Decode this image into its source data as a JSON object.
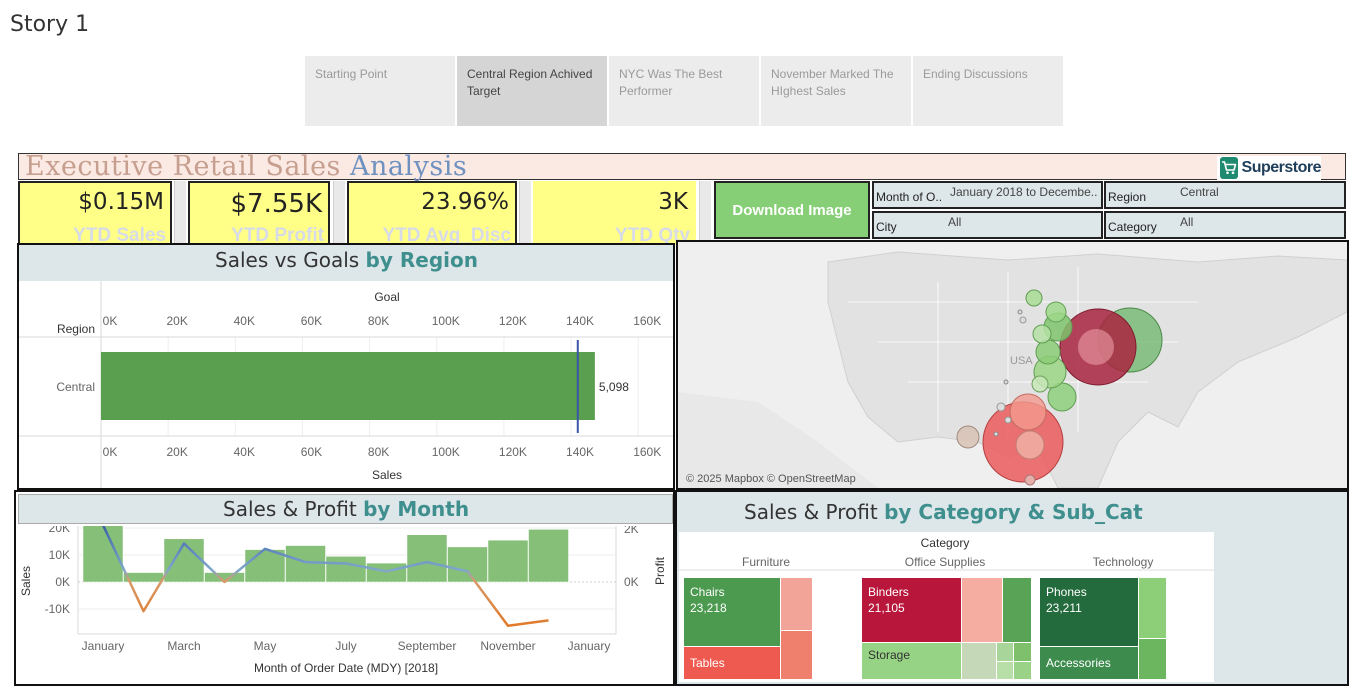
{
  "story": {
    "title": "Story 1",
    "tabs": [
      {
        "label": "Starting Point",
        "active": false
      },
      {
        "label": "Central Region Achived Target",
        "active": true
      },
      {
        "label": "NYC Was The Best Performer",
        "active": false
      },
      {
        "label": "November Marked The HIghest Sales",
        "active": false
      },
      {
        "label": "Ending Discussions",
        "active": false
      }
    ]
  },
  "banner": {
    "title_part1": "Executive Retail Sales ",
    "title_part2": "Analysis",
    "logo_text": "Superstore",
    "logo_icon": "shopping-cart-icon"
  },
  "kpis": [
    {
      "value": "$0.15M",
      "label": "YTD Sales"
    },
    {
      "value": "$7.55K",
      "label": "YTD Profit"
    },
    {
      "value": "23.96%",
      "label": "YTD Avg_Disc"
    },
    {
      "value": "3K",
      "label": "YTD Qty"
    }
  ],
  "download_label": "Download Image",
  "filters": [
    {
      "label": "Month of O..",
      "value": "January 2018 to Decembe.."
    },
    {
      "label": "Region",
      "value": "Central"
    },
    {
      "label": "City",
      "value": "All"
    },
    {
      "label": "Category",
      "value": "All"
    }
  ],
  "sales_goals": {
    "title": "Sales vs Goals ",
    "title_hl": "by Region",
    "top_axis_title": "Goal",
    "row_header": "Region",
    "bottom_axis_title": "Sales",
    "ticks": [
      "0K",
      "20K",
      "40K",
      "60K",
      "80K",
      "100K",
      "120K",
      "140K",
      "160K"
    ]
  },
  "map": {
    "attribution": "© 2025 Mapbox © OpenStreetMap",
    "country_label": "USA"
  },
  "month_panel": {
    "title": "Sales & Profit ",
    "title_hl": "by Month",
    "y_left_label": "Sales",
    "y_right_label": "Profit",
    "x_label": "Month of Order Date (MDY) [2018]",
    "left_ticks": [
      "20K",
      "10K",
      "0K",
      "-10K"
    ],
    "right_ticks": [
      "2K",
      "0K"
    ],
    "x_ticks": [
      "January",
      "March",
      "May",
      "July",
      "September",
      "November",
      "January"
    ]
  },
  "category_panel": {
    "title": "Sales & Profit ",
    "title_hl": "by Category & Sub_Cat",
    "header": "Category",
    "categories": [
      "Furniture",
      "Office Supplies",
      "Technology"
    ]
  },
  "chart_data": [
    {
      "type": "bar",
      "title": "Sales vs Goals by Region",
      "categories": [
        "Central"
      ],
      "series": [
        {
          "name": "Sales",
          "values": [
            147098
          ]
        }
      ],
      "data_labels": [
        "5,098"
      ],
      "goal": [
        142000
      ],
      "xlabel": "Sales",
      "xlim": [
        0,
        165000
      ],
      "colors": {
        "bar": "#5a9e4f",
        "goal_line": "#3b55a8"
      }
    },
    {
      "type": "bar",
      "title": "Sales & Profit by Month",
      "categories": [
        "January",
        "February",
        "March",
        "April",
        "May",
        "June",
        "July",
        "August",
        "September",
        "October",
        "November",
        "December"
      ],
      "series": [
        {
          "name": "Sales",
          "values": [
            22000,
            3500,
            16000,
            3500,
            12000,
            13500,
            9500,
            7000,
            17500,
            13000,
            15500,
            19500
          ]
        },
        {
          "name": "Profit",
          "values": [
            2150,
            -1100,
            1450,
            0,
            1250,
            750,
            700,
            400,
            750,
            400,
            -1650,
            -1450
          ]
        }
      ],
      "xlabel": "Month of Order Date (MDY) [2018]",
      "ylabel": "Sales",
      "ylim": [
        -13000,
        23000
      ],
      "y2lim": [
        -2200,
        2500
      ],
      "colors": {
        "bar": "#86bf78",
        "profit_pos": "#7a9fc4",
        "profit_neg": "#e07a2a"
      }
    },
    {
      "type": "table",
      "title": "Sales & Profit by Category & Sub_Cat",
      "groups": [
        {
          "category": "Furniture",
          "items": [
            {
              "name": "Chairs",
              "value": "23,218",
              "color": "#4b9a4f"
            },
            {
              "name": "Tables",
              "value": "",
              "color": "#ef5a50"
            }
          ]
        },
        {
          "category": "Office Supplies",
          "items": [
            {
              "name": "Binders",
              "value": "21,105",
              "color": "#b8163b"
            },
            {
              "name": "Storage",
              "value": "",
              "color": "#97d384"
            }
          ]
        },
        {
          "category": "Technology",
          "items": [
            {
              "name": "Phones",
              "value": "23,211",
              "color": "#236b3c"
            },
            {
              "name": "Accessories",
              "value": "",
              "color": "#3d8c4d"
            }
          ]
        }
      ]
    }
  ]
}
